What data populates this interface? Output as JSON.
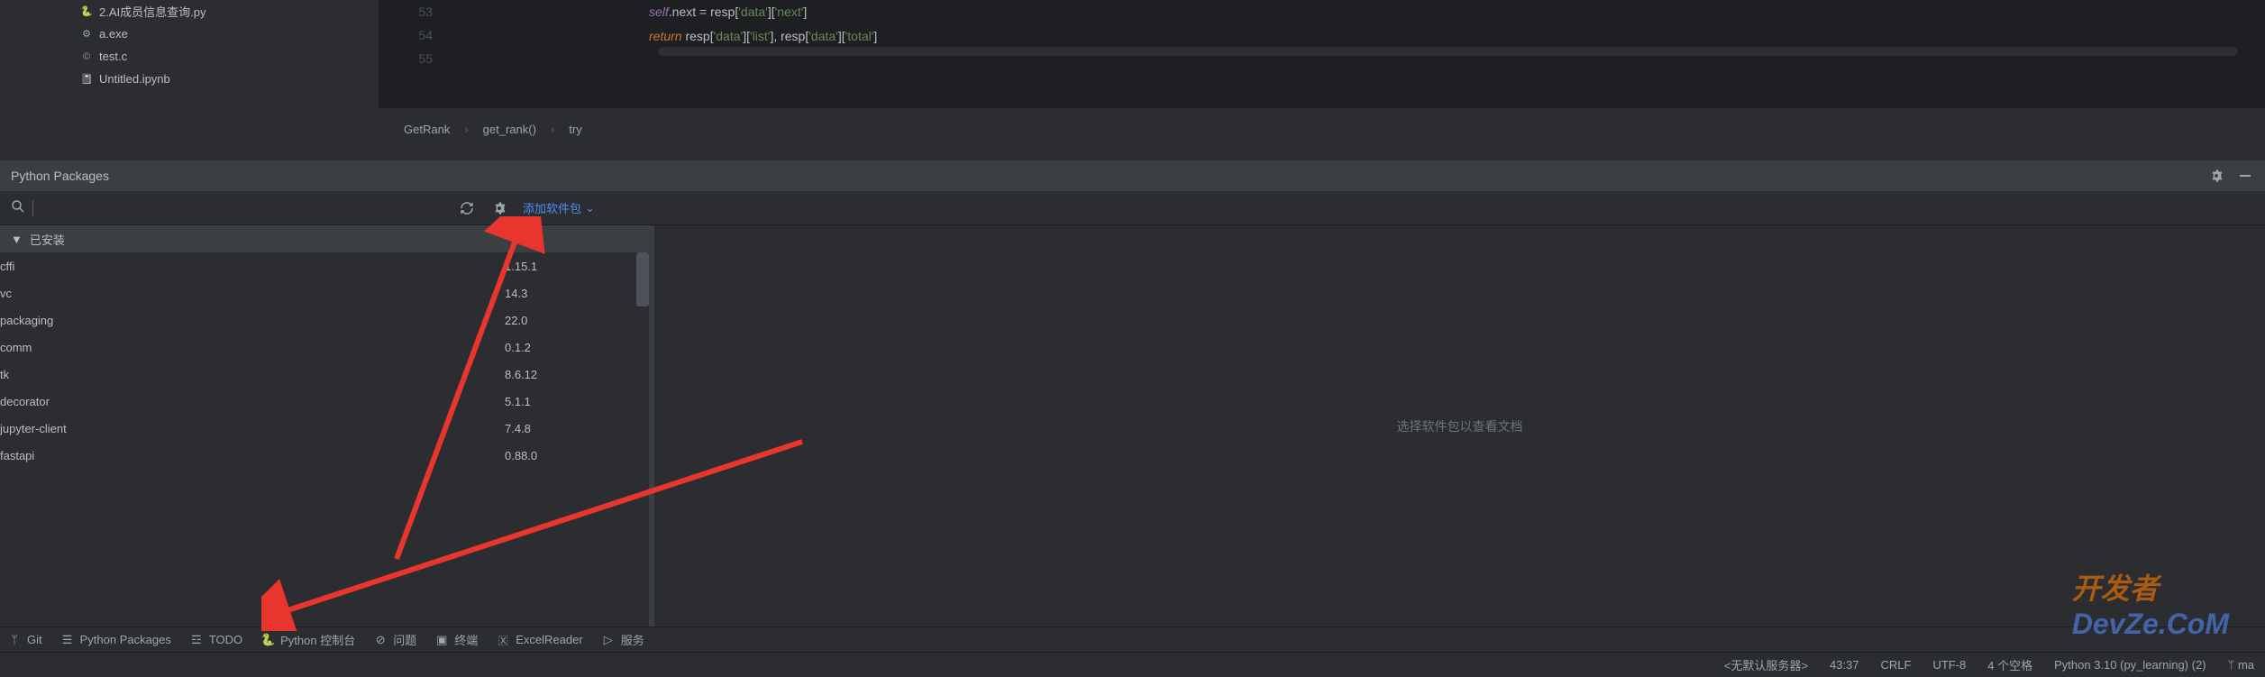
{
  "files": [
    {
      "name": "2.AI成员信息查询.py",
      "icon": "py"
    },
    {
      "name": "a.exe",
      "icon": "exe"
    },
    {
      "name": "test.c",
      "icon": "c"
    },
    {
      "name": "Untitled.ipynb",
      "icon": "ipynb"
    }
  ],
  "editor": {
    "lines": [
      "53",
      "54",
      "55"
    ],
    "code53": {
      "t1": "self",
      "t2": ".next = resp[",
      "t3": "'data'",
      "t4": "][",
      "t5": "'next'",
      "t6": "]"
    },
    "code54": {
      "t1": "return",
      "t2": " resp[",
      "t3": "'data'",
      "t4": "][",
      "t5": "'list'",
      "t6": "], resp[",
      "t7": "'data'",
      "t8": "][",
      "t9": "'total'",
      "t10": "]"
    }
  },
  "breadcrumb": [
    "GetRank",
    "get_rank()",
    "try"
  ],
  "packages_panel": {
    "title": "Python Packages",
    "add_link": "添加软件包",
    "installed_label": "已安装",
    "empty_hint": "选择软件包以查看文档",
    "list": [
      {
        "name": "cffi",
        "ver": "1.15.1"
      },
      {
        "name": "vc",
        "ver": "14.3"
      },
      {
        "name": "packaging",
        "ver": "22.0"
      },
      {
        "name": "comm",
        "ver": "0.1.2"
      },
      {
        "name": "tk",
        "ver": "8.6.12"
      },
      {
        "name": "decorator",
        "ver": "5.1.1"
      },
      {
        "name": "jupyter-client",
        "ver": "7.4.8"
      },
      {
        "name": "fastapi",
        "ver": "0.88.0"
      }
    ]
  },
  "bottom_bar": {
    "git": "Git",
    "packages": "Python Packages",
    "todo": "TODO",
    "console": "Python 控制台",
    "problems": "问题",
    "terminal": "终端",
    "excel": "ExcelReader",
    "services": "服务"
  },
  "status_bar": {
    "server": "<无默认服务器>",
    "pos": "43:37",
    "eol": "CRLF",
    "enc": "UTF-8",
    "indent": "4 个空格",
    "interp": "Python 3.10 (py_learning) (2)",
    "branch": "ma"
  },
  "watermark": {
    "p1": "开发者",
    "p2": "DevZe.CoM"
  }
}
